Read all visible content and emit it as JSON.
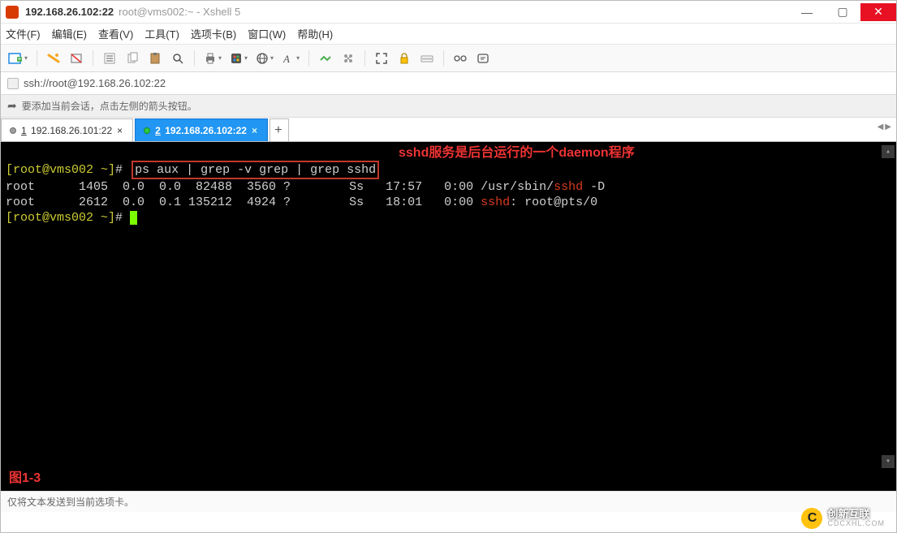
{
  "titlebar": {
    "main": "192.168.26.102:22",
    "sub": "root@vms002:~ - Xshell 5"
  },
  "menu": {
    "file": "文件(F)",
    "edit": "编辑(E)",
    "view": "查看(V)",
    "tools": "工具(T)",
    "tabs": "选项卡(B)",
    "window": "窗口(W)",
    "help": "帮助(H)"
  },
  "addressbar": {
    "url": "ssh://root@192.168.26.102:22"
  },
  "hint": {
    "text": "要添加当前会话，点击左侧的箭头按钮。"
  },
  "tabs": {
    "t1_num": "1",
    "t1_label": "192.168.26.101:22",
    "t2_num": "2",
    "t2_label": "192.168.26.102:22"
  },
  "terminal": {
    "prompt1_pre": "[root@vms002 ~]",
    "prompt1_hash": "#",
    "cmd": "ps aux | grep -v grep | grep sshd",
    "annotation": "sshd服务是后台运行的一个daemon程序",
    "line2_a": "root      1405  0.0  0.0  82488  3560 ?        Ss   17:57   0:00 /usr/sbin/",
    "line2_red": "sshd",
    "line2_b": " -D",
    "line3_a": "root      2612  0.0  0.1 135212  4924 ?        Ss   18:01   0:00 ",
    "line3_red": "sshd",
    "line3_b": ": root@pts/0",
    "prompt2_pre": "[root@vms002 ~]",
    "prompt2_hash": "#",
    "figure": "图1-3"
  },
  "statusbar": {
    "text": "仅将文本发送到当前选项卡。"
  },
  "watermark": {
    "cn": "创新互联",
    "en": "CDCXHL.COM"
  }
}
